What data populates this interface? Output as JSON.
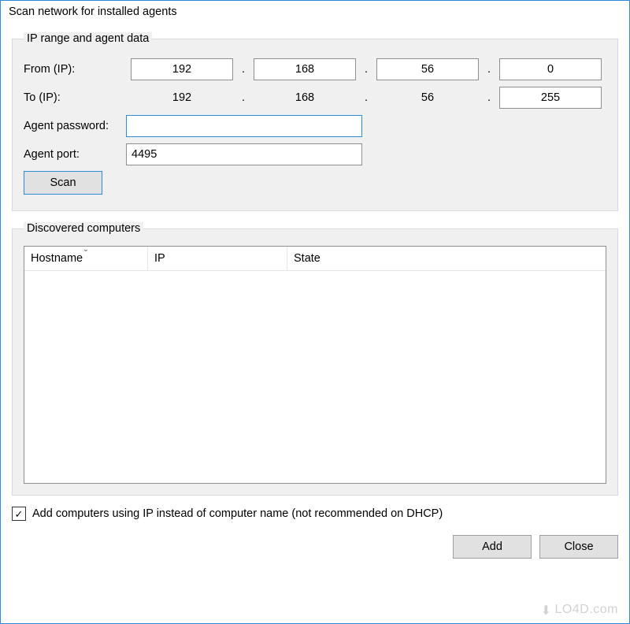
{
  "window": {
    "title": "Scan network for installed agents"
  },
  "group_ip": {
    "legend": "IP range and agent data",
    "from_label": "From (IP):",
    "to_label": "To (IP):",
    "from": {
      "o1": "192",
      "o2": "168",
      "o3": "56",
      "o4": "0"
    },
    "to": {
      "o1": "192",
      "o2": "168",
      "o3": "56",
      "o4": "255"
    },
    "dot": ".",
    "agent_password_label": "Agent password:",
    "agent_password_value": "",
    "agent_port_label": "Agent port:",
    "agent_port_value": "4495",
    "scan_label": "Scan"
  },
  "group_discovered": {
    "legend": "Discovered computers",
    "columns": {
      "hostname": "Hostname",
      "ip": "IP",
      "state": "State"
    }
  },
  "footer": {
    "checkbox_checked": true,
    "checkbox_label": "Add computers using IP instead of computer name (not recommended on DHCP)",
    "add_label": "Add",
    "close_label": "Close"
  },
  "watermark": "LO4D.com"
}
